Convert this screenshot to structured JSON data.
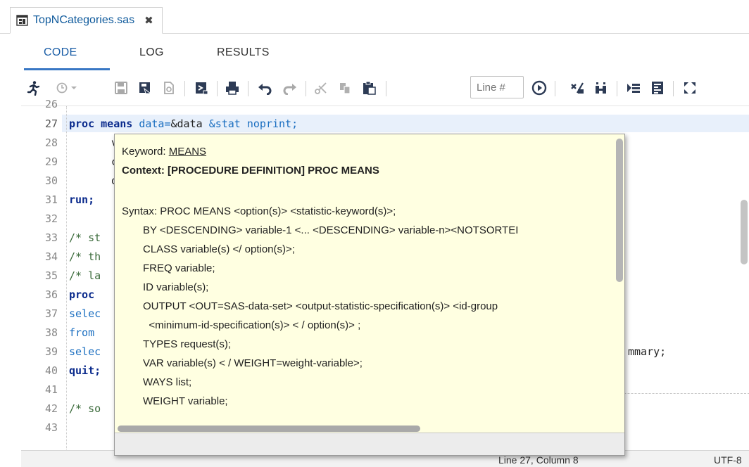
{
  "file_tab": {
    "name": "TopNCategories.sas",
    "close": "✖"
  },
  "subtabs": [
    "CODE",
    "LOG",
    "RESULTS"
  ],
  "toolbar": {
    "line_placeholder": "Line #"
  },
  "editor": {
    "lines": [
      {
        "n": "26"
      },
      {
        "n": "27"
      },
      {
        "n": "28"
      },
      {
        "n": "29"
      },
      {
        "n": "30"
      },
      {
        "n": "31"
      },
      {
        "n": "32"
      },
      {
        "n": "33"
      },
      {
        "n": "34"
      },
      {
        "n": "35"
      },
      {
        "n": "36"
      },
      {
        "n": "37"
      },
      {
        "n": "38"
      },
      {
        "n": "39"
      },
      {
        "n": "40"
      },
      {
        "n": "41"
      },
      {
        "n": "42"
      },
      {
        "n": "43"
      }
    ],
    "code": {
      "l27_a": "proc",
      "l27_b": "means",
      "l27_c": "data=",
      "l27_d": "&data",
      "l27_e": "&stat",
      "l27_f": "noprint;",
      "l28": "v",
      "l29": "c",
      "l30": "o",
      "l31": "run;",
      "l33": "/* st",
      "l34": "/* th",
      "l35": "/* la",
      "l36": "proc",
      "l37": "selec",
      "l38": "from",
      "l39": "selec",
      "l39_tail": "mmary;",
      "l40": "quit;",
      "l42": "/* so"
    }
  },
  "tooltip": {
    "keyword_label": "Keyword: ",
    "keyword": "MEANS",
    "context": "Context: [PROCEDURE DEFINITION] PROC MEANS",
    "syntax": "Syntax: PROC MEANS <option(s)> <statistic-keyword(s)>;",
    "statements": [
      "BY <DESCENDING> variable-1 <... <DESCENDING> variable-n><NOTSORTEI",
      "CLASS variable(s) </ option(s)>;",
      "FREQ variable;",
      "ID variable(s);",
      "OUTPUT <OUT=SAS-data-set> <output-statistic-specification(s)> <id-group",
      "  <minimum-id-specification(s)> < / option(s)> ;",
      "TYPES request(s);",
      "VAR variable(s) < / WEIGHT=weight-variable>;",
      "WAYS list;",
      "WEIGHT variable;"
    ]
  },
  "status": {
    "position": "Line 27, Column 8",
    "encoding": "UTF-8"
  }
}
